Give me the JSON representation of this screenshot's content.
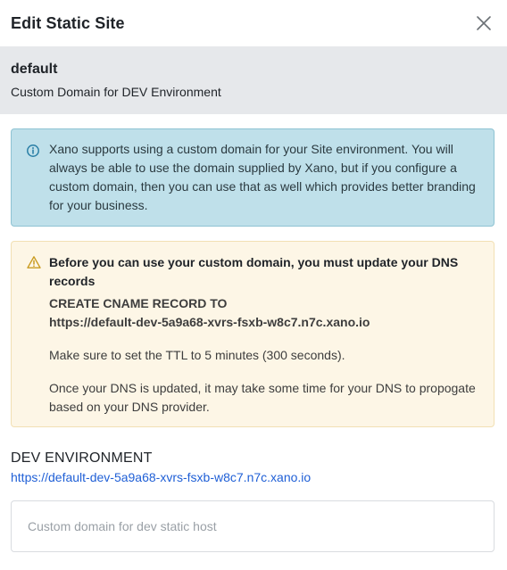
{
  "header": {
    "title": "Edit Static Site",
    "close_icon": "close-icon"
  },
  "site": {
    "name": "default",
    "description": "Custom Domain for DEV Environment"
  },
  "info": {
    "icon": "info-icon",
    "text": "Xano supports using a custom domain for your Site environment. You will always be able to use the domain supplied by Xano, but if you configure a custom domain, then you can use that as well which provides better branding for your business."
  },
  "warning": {
    "icon": "warning-icon",
    "title": "Before you can use your custom domain, you must update your DNS records",
    "cname_heading": "CREATE CNAME RECORD TO",
    "cname_target": "https://default-dev-5a9a68-xvrs-fsxb-w8c7.n7c.xano.io",
    "ttl_note": "Make sure to set the TTL to 5 minutes (300 seconds).",
    "propagation_note": "Once your DNS is updated, it may take some time for your DNS to propogate based on your DNS provider."
  },
  "environment": {
    "label": "DEV ENVIRONMENT",
    "url": "https://default-dev-5a9a68-xvrs-fsxb-w8c7.n7c.xano.io"
  },
  "domain_input": {
    "value": "",
    "placeholder": "Custom domain for dev static host"
  },
  "colors": {
    "info_bg": "#bfe0ea",
    "warning_bg": "#fdf6e6",
    "link": "#1f5fd6",
    "subheader_bg": "#e6e8eb"
  }
}
